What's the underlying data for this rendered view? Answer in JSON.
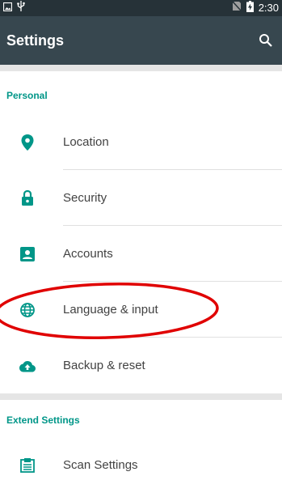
{
  "status_bar": {
    "time": "2:30",
    "icons": [
      "image-icon",
      "usb-icon",
      "no-sim-icon",
      "battery-charging-icon"
    ]
  },
  "app_bar": {
    "title": "Settings",
    "search_icon": "search-icon"
  },
  "sections": [
    {
      "header": "Personal",
      "items": [
        {
          "label": "Location",
          "icon": "location-pin-icon"
        },
        {
          "label": "Security",
          "icon": "lock-icon"
        },
        {
          "label": "Accounts",
          "icon": "account-box-icon"
        },
        {
          "label": "Language & input",
          "icon": "globe-icon"
        },
        {
          "label": "Backup & reset",
          "icon": "cloud-upload-icon"
        }
      ]
    },
    {
      "header": "Extend Settings",
      "items": [
        {
          "label": "Scan Settings",
          "icon": "scanner-icon"
        }
      ]
    }
  ],
  "colors": {
    "status_bar": "#263238",
    "app_bar": "#37474f",
    "accent": "#009688",
    "annotation": "#e00000"
  },
  "annotation": {
    "shape": "ellipse",
    "color": "#e00000",
    "target": "Language & input"
  }
}
